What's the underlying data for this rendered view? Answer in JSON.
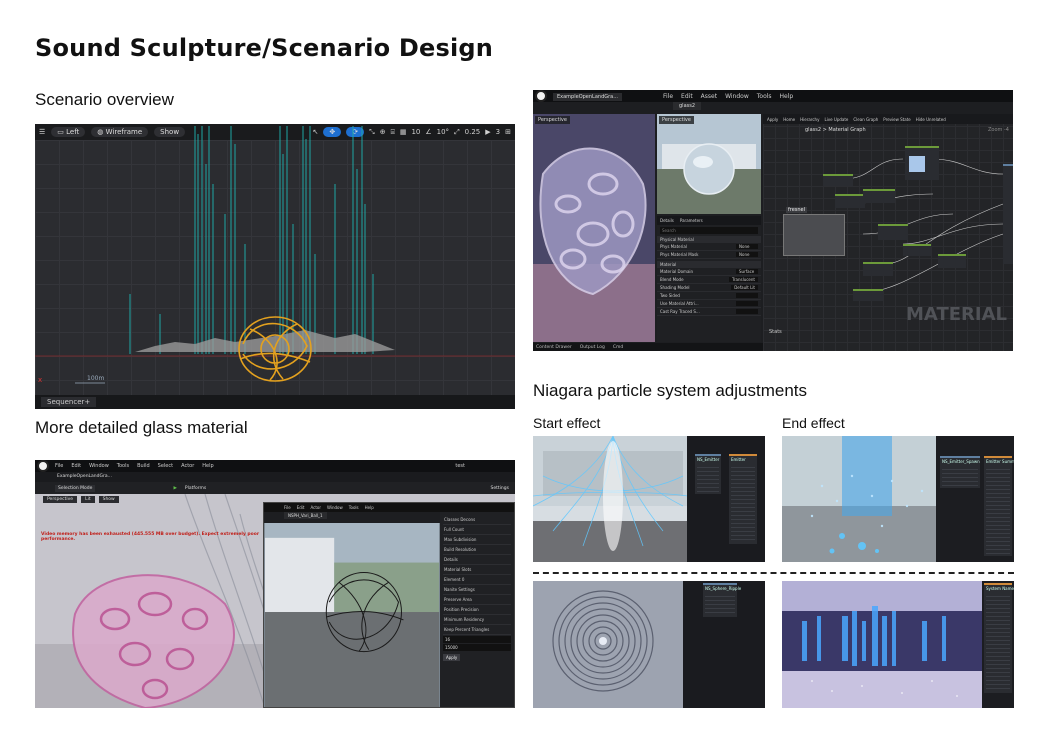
{
  "page": {
    "title": "Sound Sculpture/Scenario Design"
  },
  "captions": {
    "scenario": "Scenario overview",
    "glass": "More detailed glass material",
    "niagara": "Niagara particle system adjustments",
    "start": "Start effect",
    "end": "End effect"
  },
  "scenario_viewport": {
    "view_mode": "Left",
    "render_mode": "Wireframe",
    "show_label": "Show",
    "grid_snap": "10",
    "rotate_snap": "10°",
    "scale_snap": "0.25",
    "camera_speed": "3",
    "scale_label": "100m",
    "sequencer_tab": "Sequencer+"
  },
  "material_editor": {
    "project_tab": "ExampleOpenLandGra...",
    "asset_tab": "glass2",
    "menu": [
      "File",
      "Edit",
      "Asset",
      "Window",
      "Tools",
      "Help"
    ],
    "selection_mode": "Selection Mode",
    "perspective": "Perspective",
    "lit": "Lit",
    "show": "Show",
    "toolbar": [
      "Apply",
      "Home",
      "Hierarchy",
      "Live Update",
      "Clean Graph",
      "Preview State",
      "Hide Unrelated"
    ],
    "breadcrumb": "glass2 > Material Graph",
    "zoom": "Zoom -4",
    "watermark": "MATERIAL",
    "comment_node": "fresnel",
    "details_tab": "Details",
    "parameters_tab": "Parameters",
    "search_placeholder": "Search",
    "sections": [
      "Physical Material",
      "Material"
    ],
    "rows": [
      {
        "label": "Phys Material",
        "value": "None"
      },
      {
        "label": "Phys Material Mask",
        "value": "None"
      },
      {
        "label": "Material Domain",
        "value": "Surface"
      },
      {
        "label": "Blend Mode",
        "value": "Translucent"
      },
      {
        "label": "Shading Model",
        "value": "Default Lit"
      },
      {
        "label": "Two Sided",
        "value": ""
      },
      {
        "label": "Use Material Attri...",
        "value": ""
      },
      {
        "label": "Cast Ray Traced S...",
        "value": ""
      }
    ],
    "stats_tab": "Stats",
    "bottom_tabs": [
      "Content Drawer",
      "Output Log",
      "Cmd"
    ]
  },
  "glass_detail": {
    "menu": [
      "File",
      "Edit",
      "Window",
      "Tools",
      "Build",
      "Select",
      "Actor",
      "Help"
    ],
    "project_tab": "ExampleOpenLandGra...",
    "window_title": "test",
    "selection_mode": "Selection Mode",
    "platforms": "Platforms",
    "settings": "Settings",
    "perspective": "Perspective",
    "lit": "Lit",
    "show": "Show",
    "warning": "Video memory has been exhausted (445.555 MB over budget). Expect extremely poor performance.",
    "child_tab": "NSPH_Vari_Ball_1",
    "child_menu": [
      "File",
      "Edit",
      "Actor",
      "Window",
      "Tools",
      "Help"
    ],
    "child_mode": "Niagara",
    "inner_panel": [
      "Classes Decons",
      "Full Count",
      "Max Subdivision",
      "Build Resolution",
      "Details",
      "Material Slots",
      "Element 0",
      "Nanite Settings",
      "Preserve Area",
      "Position Precision",
      "Minimum Residency",
      "Keep Percent Triangles"
    ],
    "inner_values": [
      "16",
      "15000"
    ],
    "apply": "Apply"
  },
  "niagara": {
    "start_panel_headers": [
      "NS_Emitter",
      "Emitter"
    ],
    "end_panel_headers": [
      "NS_Emitter_Spawn",
      "Emitter Summary"
    ],
    "start_panel2_headers": [
      "NS_Sphere_Ripple"
    ],
    "end_panel2_headers": [
      "System Name"
    ]
  },
  "colors": {
    "ue_dark": "#1b1c1f",
    "accent_blue": "#1e6fd0",
    "teal_bars": "#1fa8a6",
    "orange_sphere": "#e3a11f",
    "niagara_cyan": "#5fc8ff",
    "node_green": "#6c9a3a"
  }
}
